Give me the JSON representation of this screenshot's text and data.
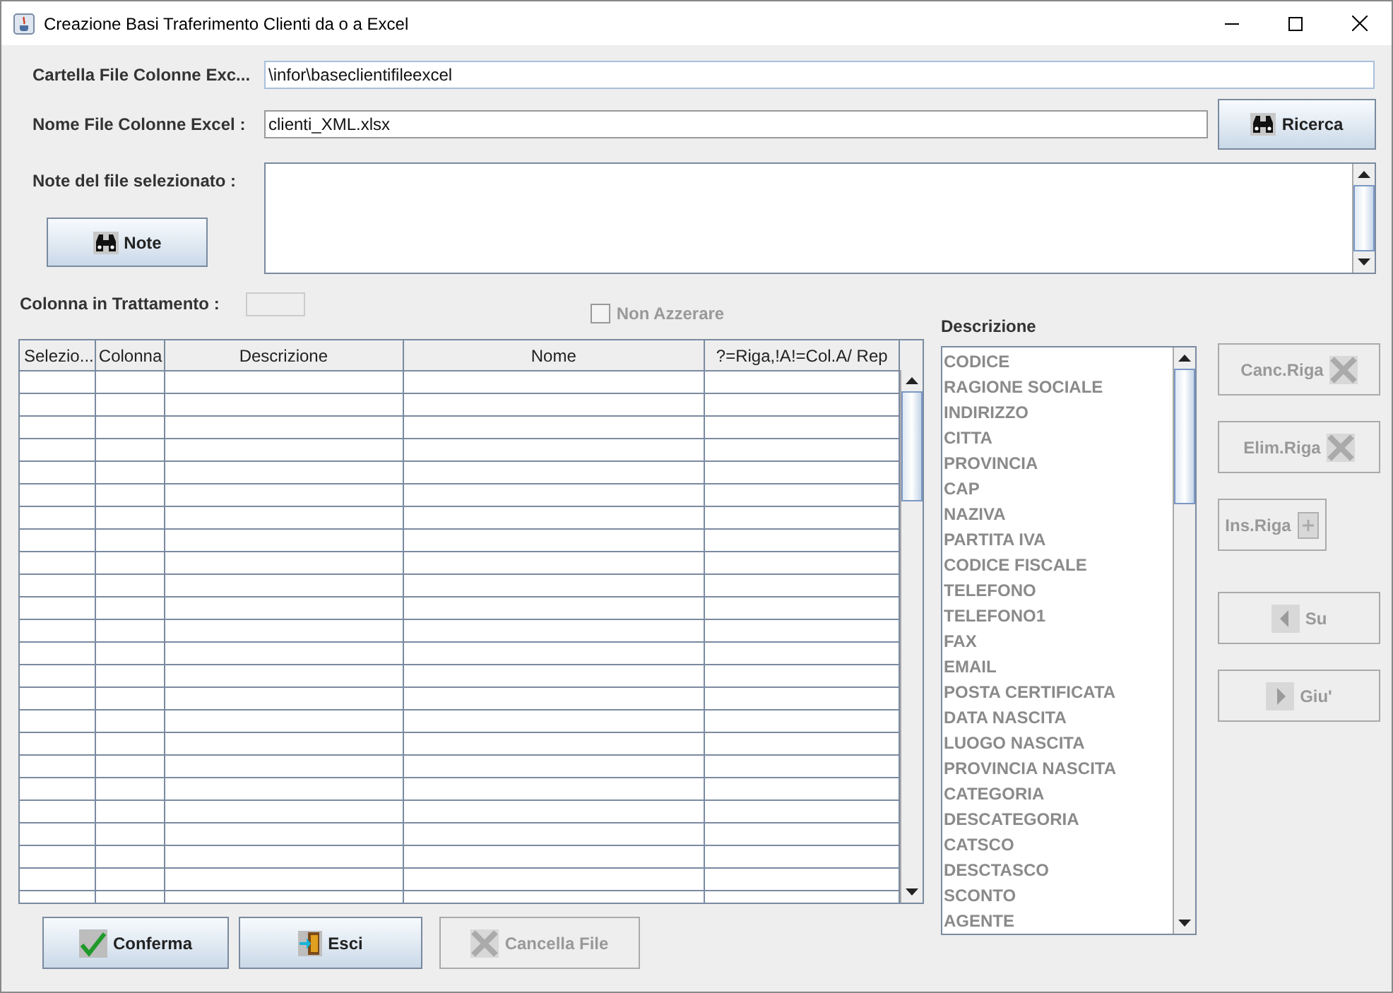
{
  "window": {
    "title": "Creazione Basi Traferimento Clienti da o a Excel"
  },
  "form": {
    "folder_label": "Cartella File Colonne Exc...",
    "folder_value": "\\infor\\baseclientifileexcel",
    "file_label": "Nome File Colonne Excel :",
    "file_value": "clienti_XML.xlsx",
    "notes_label": "Note del file selezionato :"
  },
  "search_button": {
    "label": "Ricerca",
    "disabled": false
  },
  "notes_button": {
    "label": "Note",
    "disabled": false
  },
  "column_label": "Colonna in Trattamento :",
  "reset_checkbox": {
    "label": "Non Azzerare",
    "checked": false,
    "disabled": true
  },
  "table": {
    "columns": [
      "Selezio...",
      "Colonna",
      "Descrizione",
      "Nome",
      "?=Riga,!A!=Col.A/ Rep"
    ]
  },
  "list": {
    "title": "Descrizione",
    "disabled": true,
    "items": [
      "CODICE",
      "RAGIONE SOCIALE",
      "INDIRIZZO",
      "CITTA",
      "PROVINCIA",
      "CAP",
      "NAZIVA",
      "PARTITA IVA",
      "CODICE FISCALE",
      "TELEFONO",
      "TELEFONO1",
      "FAX",
      "EMAIL",
      "POSTA CERTIFICATA",
      "DATA NASCITA",
      "LUOGO NASCITA",
      "PROVINCIA NASCITA",
      "CATEGORIA",
      "DESCATEGORIA",
      "CATSCO",
      "DESCTASCO",
      "SCONTO",
      "AGENTE"
    ]
  },
  "side_buttons": [
    {
      "label": "Canc.Riga",
      "disabled": true
    },
    {
      "label": "Elim.Riga",
      "disabled": true
    },
    {
      "label": "Ins.Riga",
      "disabled": true
    },
    {
      "label": "Su",
      "disabled": true
    },
    {
      "label": "Giu'",
      "disabled": true
    }
  ],
  "bottom_buttons": [
    {
      "label": "Conferma",
      "disabled": false
    },
    {
      "label": "Esci",
      "disabled": false
    },
    {
      "label": "Cancella File",
      "disabled": true
    }
  ]
}
